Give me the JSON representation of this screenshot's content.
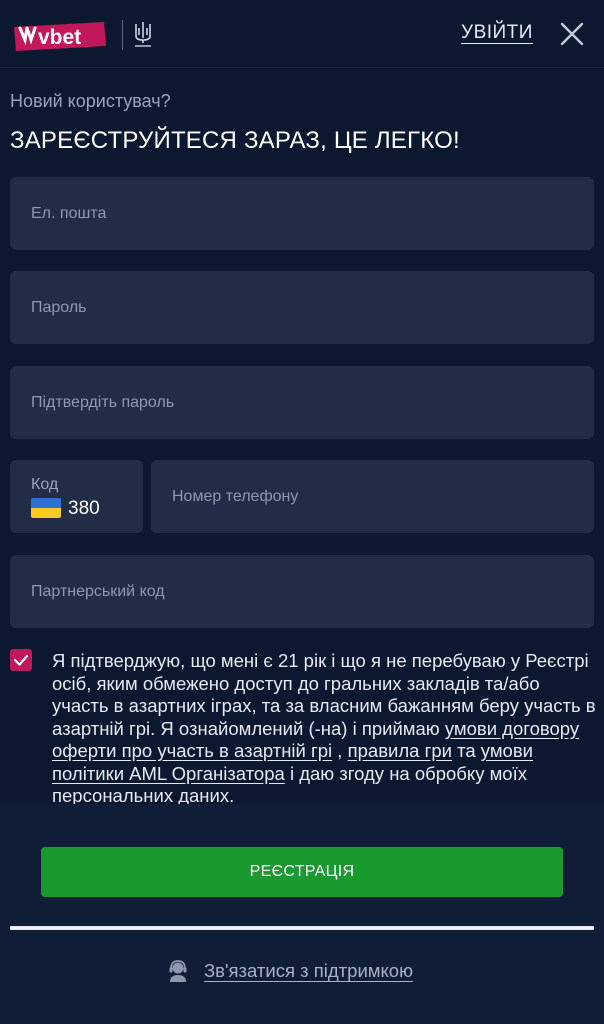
{
  "header": {
    "logo_text": "vbet",
    "login_label": "УВІЙТИ",
    "close_icon": "close-icon"
  },
  "intro": {
    "subtitle": "Новий користувач?",
    "title": "ЗАРЕЄСТРУЙТЕСЯ ЗАРАЗ, ЦЕ ЛЕГКО!"
  },
  "form": {
    "email": {
      "value": "",
      "placeholder": "Ел. пошта"
    },
    "password": {
      "value": "",
      "placeholder": "Пароль"
    },
    "confirm_password": {
      "value": "",
      "placeholder": "Підтвердіть пароль"
    },
    "phone_code": {
      "label": "Код",
      "value": "380",
      "flag": "ukraine-flag"
    },
    "phone": {
      "value": "",
      "placeholder": "Номер телефону"
    },
    "partner_code": {
      "value": "",
      "placeholder": "Партнерський код"
    }
  },
  "consent": {
    "checked": true,
    "text_1": "Я підтверджую, що мені є 21 рік і що я не перебуваю у Реєстрі осіб, яким обмежено доступ до гральних закладів та/або участь в азартних іграх, та за власним бажанням беру участь в азартній грі. Я ознайомлений (-на) і приймаю ",
    "link_1": "умови договору оферти про участь в азартній грі",
    "sep_1": " , ",
    "link_2": "правила гри",
    "sep_2": " та ",
    "link_3": "умови політики AML Організатора",
    "text_2": " і даю згоду на обробку моїх персональних даних."
  },
  "footer": {
    "register_label": "РЕЄСТРАЦІЯ",
    "support_label": "Зв'язатися з підтримкою",
    "support_icon": "support-agent-icon"
  },
  "colors": {
    "background": "#0c1830",
    "field": "#212d46",
    "accent": "#c2185b",
    "primary_button": "#199a2f"
  }
}
